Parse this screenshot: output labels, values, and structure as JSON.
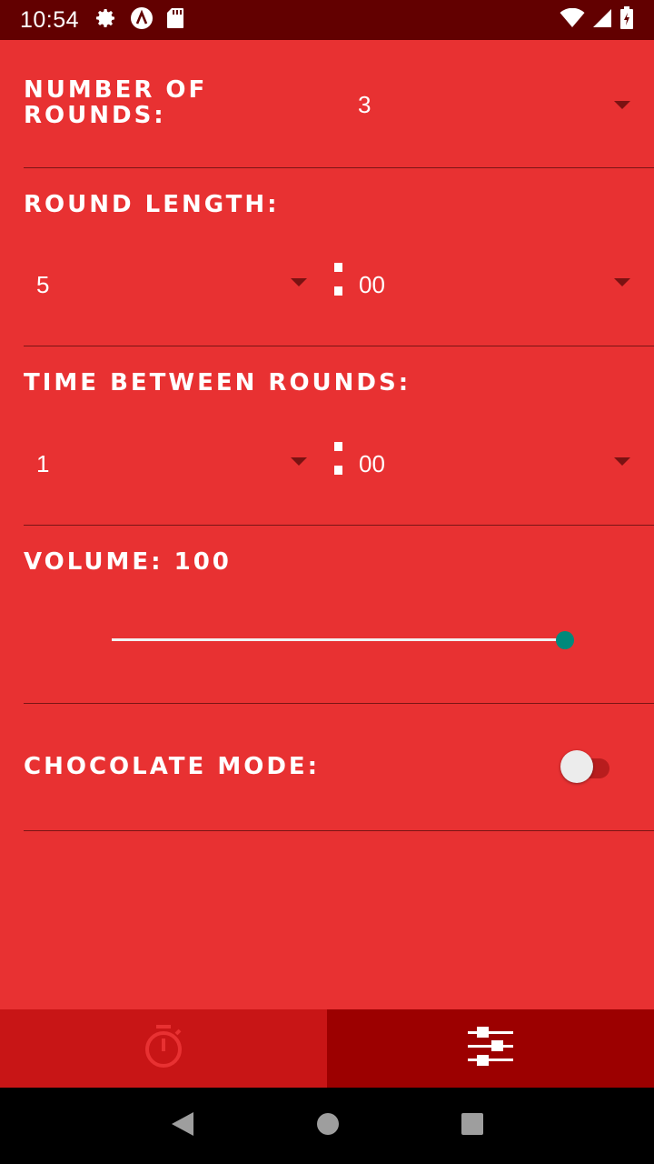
{
  "status_bar": {
    "time": "10:54",
    "icons": [
      "gear-icon",
      "a-logo-icon",
      "sd-card-icon",
      "wifi-icon",
      "signal-icon",
      "battery-icon"
    ]
  },
  "settings": {
    "rounds": {
      "label": "Number of Rounds:",
      "value": "3"
    },
    "round_length": {
      "label": "Round length:",
      "minutes": "5",
      "seconds": "00"
    },
    "time_between": {
      "label": "Time between rounds:",
      "minutes": "1",
      "seconds": "00"
    },
    "volume": {
      "label": "Volume: 100",
      "value": 100,
      "max": 100
    },
    "chocolate_mode": {
      "label": "Chocolate mode:",
      "enabled": false
    }
  },
  "bottom_nav": {
    "tabs": [
      {
        "icon": "stopwatch-icon",
        "active": false
      },
      {
        "icon": "sliders-icon",
        "active": true
      }
    ]
  },
  "colors": {
    "background": "#E83132",
    "status_bar": "#620000",
    "tab_inactive": "#C81516",
    "tab_active": "#9C0000",
    "slider_thumb": "#00897B"
  }
}
